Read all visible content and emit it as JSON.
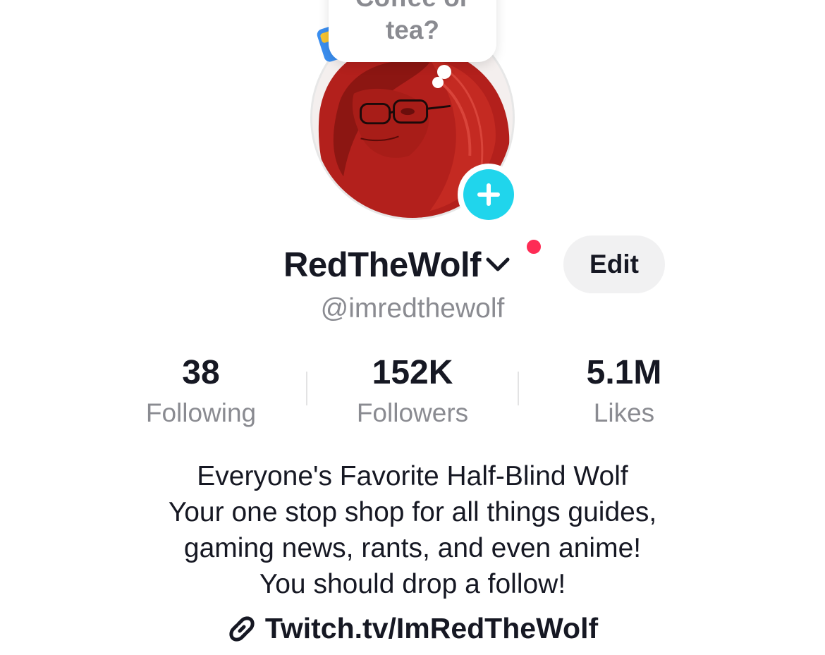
{
  "note": {
    "text_line1": "Coffee or",
    "text_line2": "tea?"
  },
  "profile": {
    "display_name": "RedTheWolf",
    "handle": "@imredthewolf",
    "edit_label": "Edit"
  },
  "stats": [
    {
      "value": "38",
      "label": "Following"
    },
    {
      "value": "152K",
      "label": "Followers"
    },
    {
      "value": "5.1M",
      "label": "Likes"
    }
  ],
  "bio": {
    "lines": [
      "Everyone's Favorite Half-Blind Wolf",
      "Your one stop shop for all things guides,",
      "gaming news, rants, and even anime!",
      "You should drop a follow!"
    ]
  },
  "link": {
    "text": "Twitch.tv/ImRedTheWolf",
    "icon": "link-icon"
  },
  "colors": {
    "accent_cyan": "#20d5ec",
    "notification_red": "#fe2c55",
    "secondary_text": "#8a8b91",
    "edit_button_bg": "#f1f1f2"
  }
}
